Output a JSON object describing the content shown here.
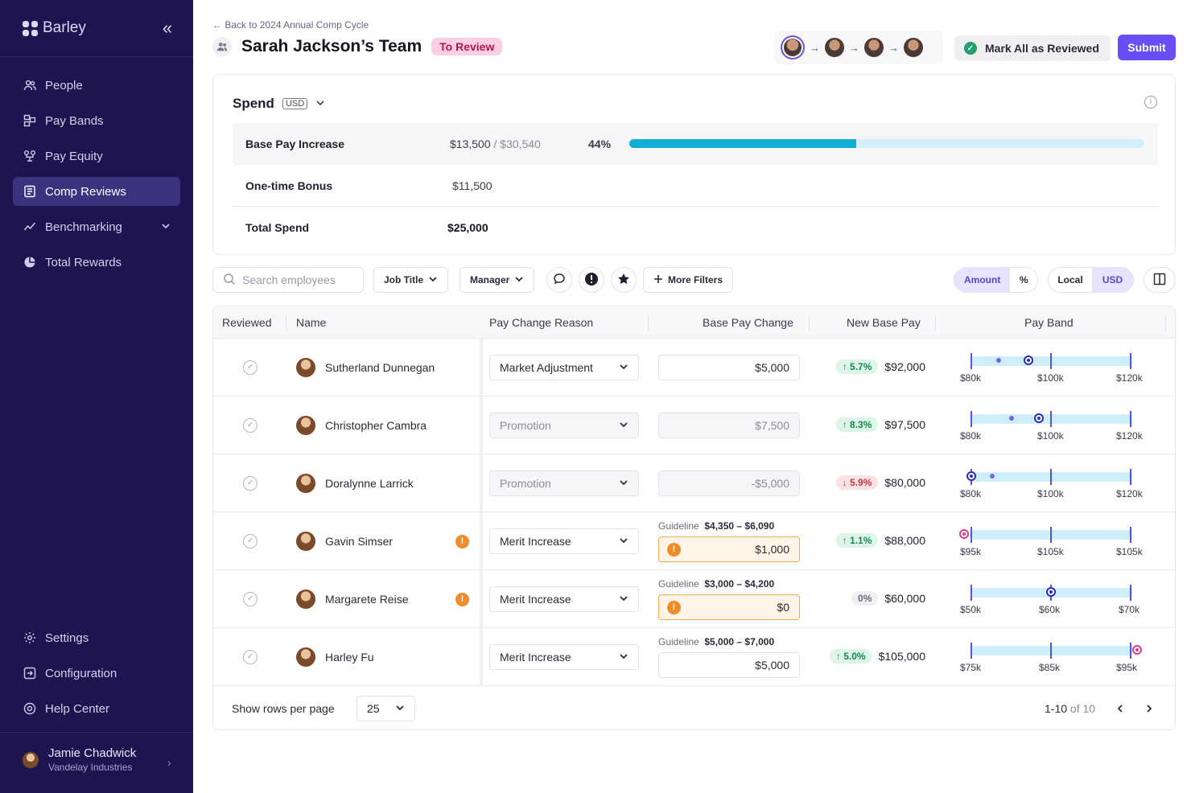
{
  "sidebar": {
    "brand": "Barley",
    "nav": [
      {
        "label": "People",
        "icon": "people-icon"
      },
      {
        "label": "Pay Bands",
        "icon": "pay-bands-icon"
      },
      {
        "label": "Pay Equity",
        "icon": "pay-equity-icon"
      },
      {
        "label": "Comp Reviews",
        "icon": "comp-reviews-icon",
        "active": true
      },
      {
        "label": "Benchmarking",
        "icon": "trend-icon"
      },
      {
        "label": "Total Rewards",
        "icon": "pie-icon"
      }
    ],
    "bottom_nav": [
      {
        "label": "Settings",
        "icon": "gear-icon"
      },
      {
        "label": "Configuration",
        "icon": "configuration-icon"
      },
      {
        "label": "Help Center",
        "icon": "help-icon"
      }
    ],
    "user": {
      "name": "Jamie Chadwick",
      "org": "Vandelay Industries"
    }
  },
  "header": {
    "back_link": "Back to 2024 Annual Comp Cycle",
    "title": "Sarah Jackson’s Team",
    "status": "To Review",
    "mark_reviewed": "Mark All as Reviewed",
    "submit": "Submit"
  },
  "spend": {
    "title": "Spend",
    "currency": "USD",
    "base_label": "Base Pay Increase",
    "base_value": "$13,500",
    "base_total": "$30,540",
    "base_pct": "44%",
    "base_progress": 0.44,
    "bonus_label": "One-time Bonus",
    "bonus_value": "$11,500",
    "total_label": "Total Spend",
    "total_value": "$25,000"
  },
  "toolbar": {
    "search_placeholder": "Search employees",
    "job_title": "Job Title",
    "manager": "Manager",
    "more_filters": "More Filters",
    "amount": "Amount",
    "percent": "%",
    "local": "Local",
    "usd": "USD"
  },
  "table": {
    "headers": {
      "reviewed": "Reviewed",
      "name": "Name",
      "reason": "Pay Change Reason",
      "base_change": "Base Pay Change",
      "new_base": "New Base Pay",
      "band": "Pay Band"
    },
    "guideline_label": "Guideline",
    "rows": [
      {
        "name": "Sutherland Dunnegan",
        "reason": "Market Adjustment",
        "change": "$5,000",
        "pct": "5.7%",
        "new_base": "$92,000",
        "band_labels": [
          "$80k",
          "$100k",
          "$120k"
        ]
      },
      {
        "name": "Christopher Cambra",
        "reason": "Promotion",
        "change": "$7,500",
        "pct": "8.3%",
        "new_base": "$97,500",
        "band_labels": [
          "$80k",
          "$100k",
          "$120k"
        ]
      },
      {
        "name": "Doralynne Larrick",
        "reason": "Promotion",
        "change": "-$5,000",
        "pct": "5.9%",
        "new_base": "$80,000",
        "band_labels": [
          "$80k",
          "$100k",
          "$120k"
        ]
      },
      {
        "name": "Gavin Simser",
        "reason": "Merit Increase",
        "guideline": "$4,350 – $6,090",
        "change": "$1,000",
        "pct": "1.1%",
        "new_base": "$88,000",
        "band_labels": [
          "$95k",
          "$105k",
          "$105k"
        ]
      },
      {
        "name": "Margarete Reise",
        "reason": "Merit Increase",
        "guideline": "$3,000 – $4,200",
        "change": "$0",
        "pct": "0%",
        "new_base": "$60,000",
        "band_labels": [
          "$50k",
          "$60k",
          "$70k"
        ]
      },
      {
        "name": "Harley Fu",
        "reason": "Merit Increase",
        "guideline": "$5,000 – $7,000",
        "change": "$5,000",
        "pct": "5.0%",
        "new_base": "$105,000",
        "band_labels": [
          "$75k",
          "$85k",
          "$95k"
        ]
      }
    ]
  },
  "footer": {
    "rows_label": "Show rows per page",
    "rows_value": "25",
    "range": "1-10",
    "of_total": "of 10"
  },
  "colors": {
    "sidebar": "#1d1550",
    "accent": "#6b4df5",
    "progress": "#12aed6",
    "band_fill": "#cdeefa",
    "warning": "#ee8d2b",
    "positive": "#15884f",
    "negative": "#c83246"
  }
}
